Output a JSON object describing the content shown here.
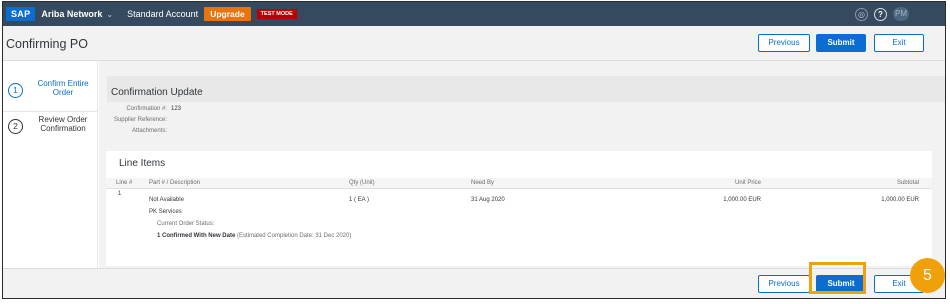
{
  "topbar": {
    "logo": "SAP",
    "network": "Ariba Network",
    "network_chevron": "⌄",
    "account": "Standard Account",
    "upgrade": "Upgrade",
    "test_mode": "TEST MODE",
    "settings_icon": "◎",
    "help_icon": "?",
    "avatar": "PM"
  },
  "header": {
    "title": "Confirming PO",
    "previous": "Previous",
    "submit": "Submit",
    "exit": "Exit"
  },
  "steps": [
    {
      "num": "1",
      "label": "Confirm Entire Order"
    },
    {
      "num": "2",
      "label": "Review Order Confirmation"
    }
  ],
  "confirmation": {
    "title": "Confirmation Update",
    "fields": [
      {
        "label": "Confirmation #:",
        "value": "123"
      },
      {
        "label": "Supplier Reference:",
        "value": ""
      },
      {
        "label": "Attachments:",
        "value": ""
      }
    ]
  },
  "line_items": {
    "title": "Line Items",
    "columns": [
      "Line #",
      "Part # / Description",
      "Qty (Unit)",
      "Need By",
      "Unit Price",
      "Subtotal"
    ],
    "row": {
      "line": "1",
      "part": "Not Available",
      "description": "PK Services",
      "qty": "1 ( EA )",
      "need_by": "31 Aug 2020",
      "unit_price": "1,000.00 EUR",
      "subtotal": "1,000.00 EUR",
      "status_label": "Current Order Status:",
      "status_value": "1  Confirmed With New Date",
      "status_note": "(Estimated Completion Date: 31 Dec 2020)"
    }
  },
  "footer": {
    "previous": "Previous",
    "submit": "Submit",
    "exit": "Exit"
  },
  "annotation": {
    "step": "5"
  },
  "colors": {
    "accent": "#0a6ed1",
    "shell": "#354a5f",
    "highlight": "#f0a10a",
    "upgrade": "#e9730c",
    "test_mode": "#bb0000"
  }
}
